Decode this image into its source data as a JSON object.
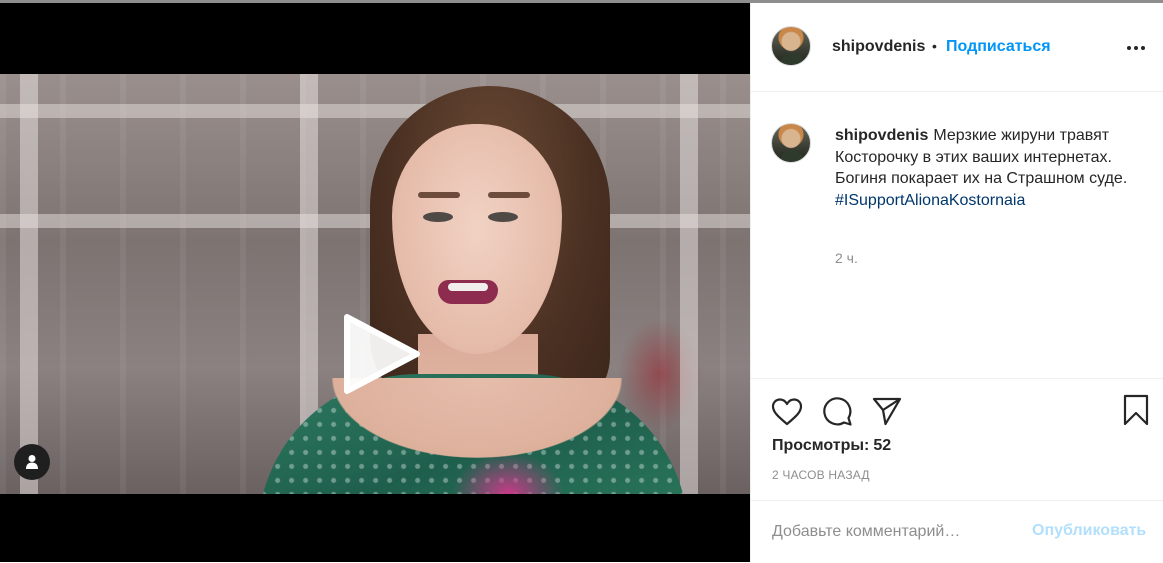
{
  "post": {
    "username": "shipovdenis",
    "follow_separator": "•",
    "follow_label": "Подписаться",
    "caption_text": "Мерзкие жируни травят Косторочку в этих ваших интернетах. Богиня покарает их на Страшном суде.",
    "hashtag": "#ISupportAlionaKostornaia",
    "caption_time": "2 ч.",
    "views_label": "Просмотры:",
    "views_count": "52",
    "timestamp": "2 часов назад",
    "comment_placeholder": "Добавьте комментарий…",
    "publish_label": "Опубликовать"
  },
  "icons": {
    "more": "more-options-icon",
    "like": "heart-icon",
    "comment": "comment-bubble-icon",
    "share": "paper-plane-icon",
    "save": "bookmark-icon",
    "play": "play-icon",
    "user_tag": "user-tag-icon"
  },
  "colors": {
    "accent": "#0095f6",
    "publish_disabled": "#b2dffc",
    "hashtag": "#00376b",
    "muted": "#8e8e8e",
    "text": "#262626"
  }
}
